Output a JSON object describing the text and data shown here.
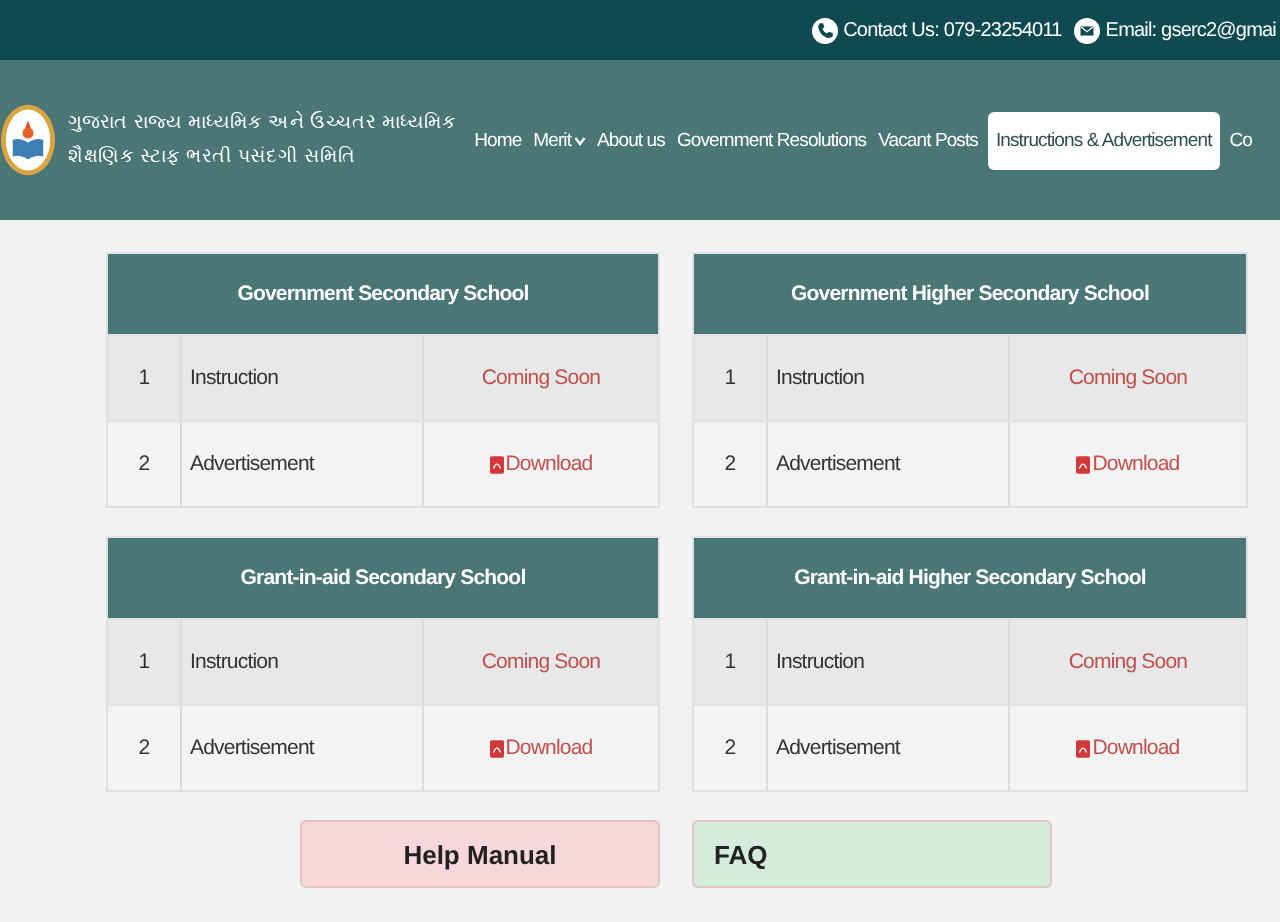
{
  "top_bar": {
    "contact": "Contact Us: 079-23254011",
    "email": "Email: gserc2@gmai"
  },
  "header": {
    "title_line_1": "ગુજરાત રાજ્ય માધ્યમિક અને ઉચ્ચતર માધ્યમિક",
    "title_line_2": "શૈક્ષણિક સ્ટાફ ભરતી પસંદગી સમિતિ"
  },
  "nav": [
    {
      "label": "Home",
      "selected": false,
      "dropdown": false
    },
    {
      "label": "Merit",
      "selected": false,
      "dropdown": true
    },
    {
      "label": "About us",
      "selected": false,
      "dropdown": false
    },
    {
      "label": "Government Resolutions",
      "selected": false,
      "dropdown": false
    },
    {
      "label": "Vacant Posts",
      "selected": false,
      "dropdown": false
    },
    {
      "label": "Instructions & Advertisement",
      "selected": true,
      "dropdown": false
    },
    {
      "label": "Co",
      "selected": false,
      "dropdown": false
    }
  ],
  "sections": [
    {
      "title": "Government Secondary School",
      "rows": [
        {
          "number": "1",
          "name": "Instruction",
          "kind": "status",
          "action": "Coming Soon"
        },
        {
          "number": "2",
          "name": "Advertisement",
          "kind": "download",
          "action": "Download"
        }
      ]
    },
    {
      "title": "Government Higher Secondary School",
      "rows": [
        {
          "number": "1",
          "name": "Instruction",
          "kind": "status",
          "action": "Coming Soon"
        },
        {
          "number": "2",
          "name": "Advertisement",
          "kind": "download",
          "action": "Download"
        }
      ]
    },
    {
      "title": "Grant-in-aid Secondary School",
      "rows": [
        {
          "number": "1",
          "name": "Instruction",
          "kind": "status",
          "action": "Coming Soon"
        },
        {
          "number": "2",
          "name": "Advertisement",
          "kind": "download",
          "action": "Download"
        }
      ]
    },
    {
      "title": "Grant-in-aid Higher Secondary School",
      "rows": [
        {
          "number": "1",
          "name": "Instruction",
          "kind": "status",
          "action": "Coming Soon"
        },
        {
          "number": "2",
          "name": "Advertisement",
          "kind": "download",
          "action": "Download"
        }
      ]
    }
  ],
  "cards": [
    {
      "label": "Help Manual",
      "color": "#f8d7da"
    },
    {
      "label": "FAQ",
      "color": "#d4edda"
    }
  ]
}
